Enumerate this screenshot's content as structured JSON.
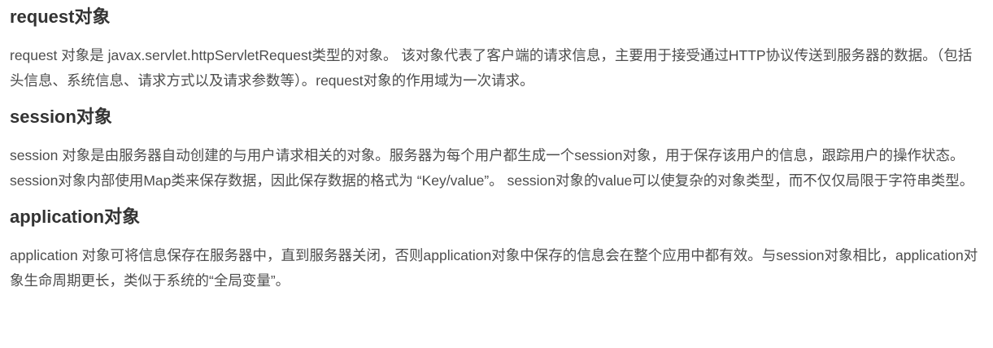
{
  "sections": [
    {
      "heading": "request对象",
      "body": "request 对象是 javax.servlet.httpServletRequest类型的对象。 该对象代表了客户端的请求信息，主要用于接受通过HTTP协议传送到服务器的数据。（包括头信息、系统信息、请求方式以及请求参数等）。request对象的作用域为一次请求。"
    },
    {
      "heading": "session对象",
      "body": "session 对象是由服务器自动创建的与用户请求相关的对象。服务器为每个用户都生成一个session对象，用于保存该用户的信息，跟踪用户的操作状态。session对象内部使用Map类来保存数据，因此保存数据的格式为 “Key/value”。 session对象的value可以使复杂的对象类型，而不仅仅局限于字符串类型。"
    },
    {
      "heading": "application对象",
      "body": "application 对象可将信息保存在服务器中，直到服务器关闭，否则application对象中保存的信息会在整个应用中都有效。与session对象相比，application对象生命周期更长，类似于系统的“全局变量”。"
    }
  ]
}
